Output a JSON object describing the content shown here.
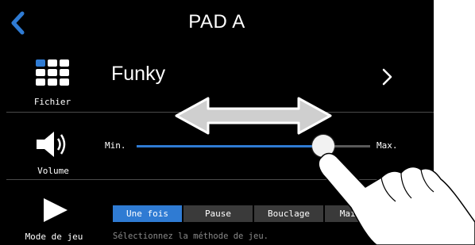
{
  "header": {
    "title": "PAD A"
  },
  "file": {
    "caption": "Fichier",
    "name": "Funky"
  },
  "volume": {
    "caption": "Volume",
    "min_label": "Min.",
    "max_label": "Max.",
    "level_fraction": 0.8
  },
  "play_mode": {
    "caption": "Mode de jeu",
    "options": [
      "Une fois",
      "Pause",
      "Bouclage",
      "Main"
    ],
    "selected_index": 0,
    "hint": "Sélectionnez la méthode de jeu."
  },
  "colors": {
    "accent": "#2f7bd3",
    "background": "#000000",
    "text": "#ffffff"
  },
  "icons": {
    "back": "chevron-left-icon",
    "file": "grid-icon",
    "forward": "chevron-right-icon",
    "volume": "speaker-icon",
    "play": "play-icon"
  }
}
